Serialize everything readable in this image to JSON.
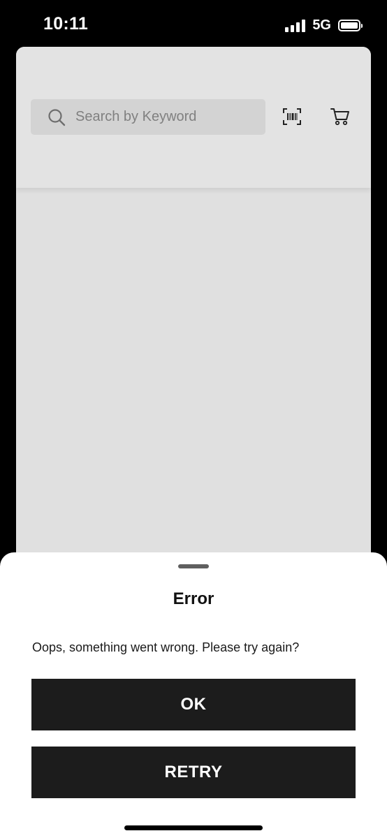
{
  "status_bar": {
    "time": "10:11",
    "network": "5G",
    "signal_bars": 4,
    "battery_level": 1.0
  },
  "header": {
    "search": {
      "placeholder": "Search by Keyword",
      "value": ""
    },
    "icons": {
      "search": "search-icon",
      "barcode": "barcode-scan-icon",
      "cart": "cart-icon"
    }
  },
  "dialog": {
    "title": "Error",
    "message": "Oops, something went wrong. Please try again?",
    "ok_label": "OK",
    "retry_label": "RETRY"
  },
  "colors": {
    "background": "#000000",
    "app_surface": "#e0e0e0",
    "search_field": "#d3d3d3",
    "sheet": "#ffffff",
    "button": "#1c1c1c",
    "button_text": "#ffffff"
  }
}
